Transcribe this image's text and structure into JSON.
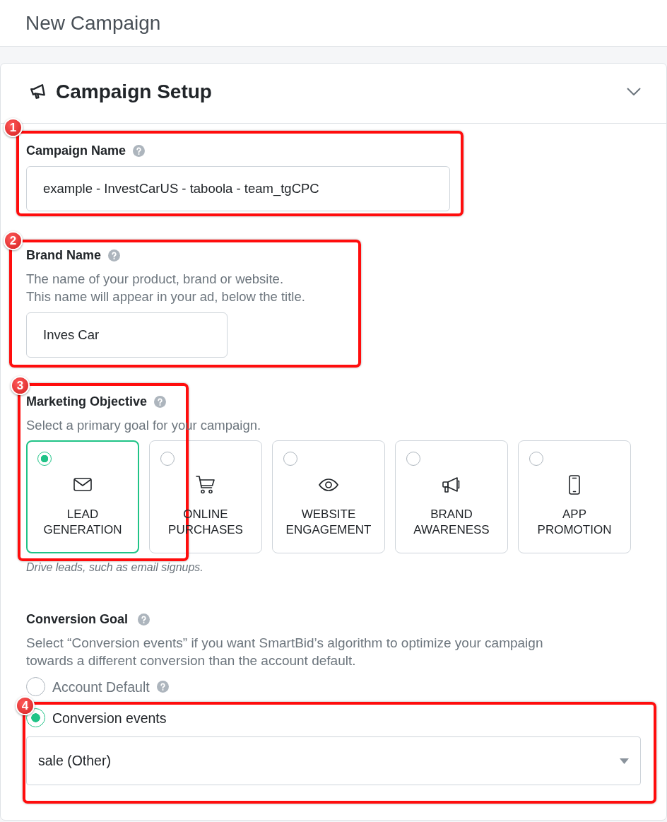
{
  "header": {
    "title": "New Campaign"
  },
  "panel": {
    "title": "Campaign Setup",
    "expanded": true
  },
  "campaign_name": {
    "label": "Campaign Name",
    "value": "example - InvestCarUS - taboola - team_tgCPC",
    "callout": "1"
  },
  "brand_name": {
    "label": "Brand Name",
    "description": [
      "The name of your product, brand or website.",
      "This name will appear in your ad, below the title."
    ],
    "value": "Inves Car",
    "callout": "2"
  },
  "marketing_objective": {
    "label": "Marketing Objective",
    "description": "Select a primary goal for your campaign.",
    "options": [
      {
        "kind": "lead",
        "label": "LEAD GENERATION",
        "selected": true
      },
      {
        "kind": "purchases",
        "label": "ONLINE PURCHASES",
        "selected": false
      },
      {
        "kind": "engagement",
        "label": "WEBSITE ENGAGEMENT",
        "selected": false
      },
      {
        "kind": "awareness",
        "label": "BRAND AWARENESS",
        "selected": false
      },
      {
        "kind": "app",
        "label": "APP PROMOTION",
        "selected": false
      }
    ],
    "hint": "Drive leads, such as email signups.",
    "callout": "3"
  },
  "conversion_goal": {
    "label": "Conversion Goal",
    "description": "Select “Conversion events” if you want SmartBid’s algorithm to optimize your campaign towards a different conversion than the account default.",
    "options": [
      {
        "label": "Account Default",
        "selected": false,
        "help": true
      },
      {
        "label": "Conversion events",
        "selected": true,
        "help": false,
        "select_value": "sale (Other)",
        "callout": "4"
      }
    ]
  }
}
